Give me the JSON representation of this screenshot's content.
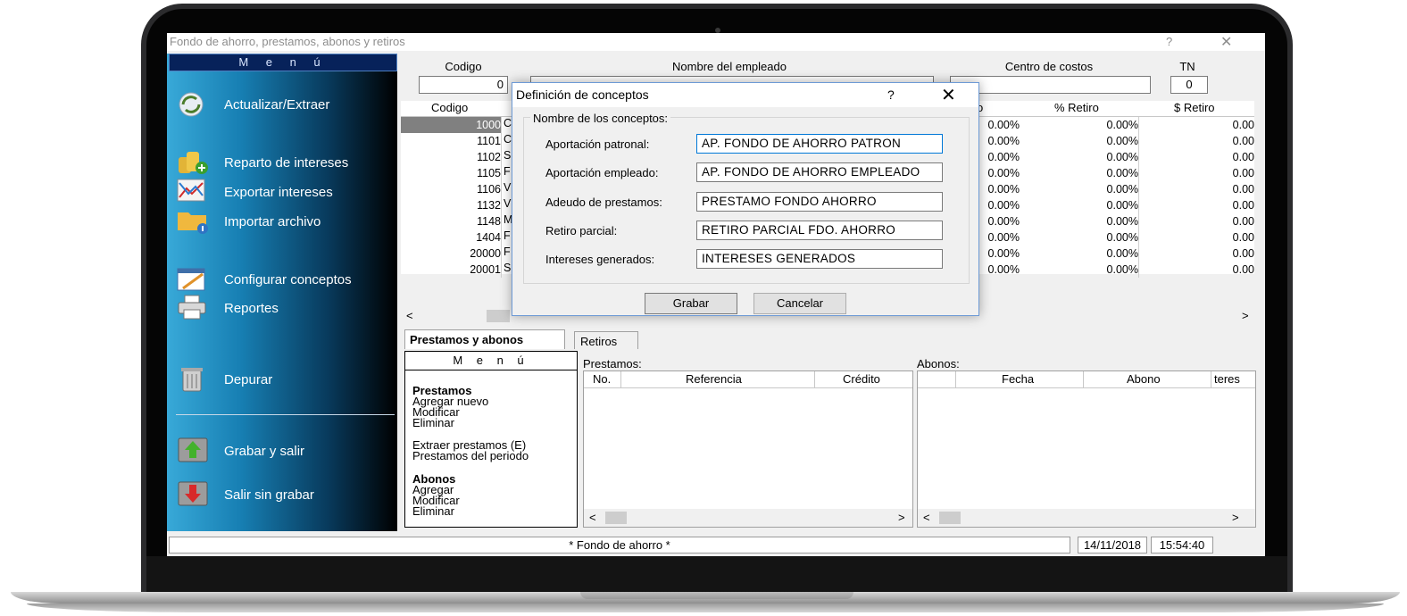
{
  "window": {
    "title": "Fondo de ahorro, prestamos, abonos y retiros",
    "help": "?",
    "close": "✕"
  },
  "menu": {
    "title": "M e n ú",
    "items": [
      {
        "label": "Actualizar/Extraer",
        "icon": "refresh-icon"
      },
      {
        "label": "Reparto de intereses",
        "icon": "coins-icon"
      },
      {
        "label": "Exportar intereses",
        "icon": "export-chart-icon"
      },
      {
        "label": "Importar archivo",
        "icon": "import-folder-icon"
      },
      {
        "label": "Configurar conceptos",
        "icon": "configure-icon"
      },
      {
        "label": "Reportes",
        "icon": "printer-icon"
      },
      {
        "label": "Depurar",
        "icon": "trash-icon"
      },
      {
        "label": "Grabar y salir",
        "icon": "save-up-icon"
      },
      {
        "label": "Salir sin grabar",
        "icon": "exit-down-icon"
      }
    ]
  },
  "header": {
    "codigo_label": "Codigo",
    "codigo_value": "0",
    "nombre_label": "Nombre del empleado",
    "nombre_value": "",
    "centro_label": "Centro de costos",
    "centro_value": "",
    "tn_label": "TN",
    "tn_value": "0"
  },
  "grid": {
    "columns": [
      "Codigo",
      "o",
      "% Retiro",
      "$ Retiro"
    ],
    "rows": [
      {
        "codigo": "1000",
        "ini": "C",
        "pct_a": "0.00%",
        "pct_retiro": "0.00%",
        "retiro": "0.00"
      },
      {
        "codigo": "1101",
        "ini": "C",
        "pct_a": "0.00%",
        "pct_retiro": "0.00%",
        "retiro": "0.00"
      },
      {
        "codigo": "1102",
        "ini": "S",
        "pct_a": "0.00%",
        "pct_retiro": "0.00%",
        "retiro": "0.00"
      },
      {
        "codigo": "1105",
        "ini": "F",
        "pct_a": "0.00%",
        "pct_retiro": "0.00%",
        "retiro": "0.00"
      },
      {
        "codigo": "1106",
        "ini": "V",
        "pct_a": "0.00%",
        "pct_retiro": "0.00%",
        "retiro": "0.00"
      },
      {
        "codigo": "1132",
        "ini": "V",
        "pct_a": "0.00%",
        "pct_retiro": "0.00%",
        "retiro": "0.00"
      },
      {
        "codigo": "1148",
        "ini": "M",
        "pct_a": "0.00%",
        "pct_retiro": "0.00%",
        "retiro": "0.00"
      },
      {
        "codigo": "1404",
        "ini": "F",
        "pct_a": "0.00%",
        "pct_retiro": "0.00%",
        "retiro": "0.00"
      },
      {
        "codigo": "20000",
        "ini": "F",
        "pct_a": "0.00%",
        "pct_retiro": "0.00%",
        "retiro": "0.00"
      },
      {
        "codigo": "20001",
        "ini": "S",
        "pct_a": "0.00%",
        "pct_retiro": "0.00%",
        "retiro": "0.00"
      }
    ],
    "scroll_left": "<",
    "scroll_right": ">"
  },
  "tabs": [
    {
      "label": "Prestamos y abonos",
      "active": true
    },
    {
      "label": "Retiros",
      "active": false
    }
  ],
  "submenu": {
    "title": "M e n ú",
    "prestamos_heading": "Prestamos",
    "prestamos_items": [
      "Agregar nuevo",
      "Modificar",
      "Eliminar"
    ],
    "extra_items": [
      "Extraer prestamos (E)",
      "Prestamos del periodo"
    ],
    "abonos_heading": "Abonos",
    "abonos_items": [
      "Agregar",
      "Modificar",
      "Eliminar"
    ]
  },
  "prestamos": {
    "label": "Prestamos:",
    "columns": [
      "No.",
      "Referencia",
      "Crédito"
    ]
  },
  "abonos": {
    "label": "Abonos:",
    "columns": [
      "",
      "Fecha",
      "Abono",
      "teres"
    ]
  },
  "statusbar": {
    "message": "* Fondo de ahorro *",
    "date": "14/11/2018",
    "time": "15:54:40"
  },
  "dialog": {
    "title": "Definición de conceptos",
    "help": "?",
    "close": "✕",
    "group_label": "Nombre de los conceptos:",
    "fields": [
      {
        "label": "Aportación patronal:",
        "value": "AP. FONDO DE AHORRO PATRON"
      },
      {
        "label": "Aportación empleado:",
        "value": "AP. FONDO DE AHORRO EMPLEADO"
      },
      {
        "label": "Adeudo de prestamos:",
        "value": "PRESTAMO FONDO AHORRO"
      },
      {
        "label": "Retiro parcial:",
        "value": "RETIRO PARCIAL FDO. AHORRO"
      },
      {
        "label": "Intereses generados:",
        "value": "INTERESES GENERADOS"
      }
    ],
    "save_label": "Grabar",
    "cancel_label": "Cancelar"
  }
}
